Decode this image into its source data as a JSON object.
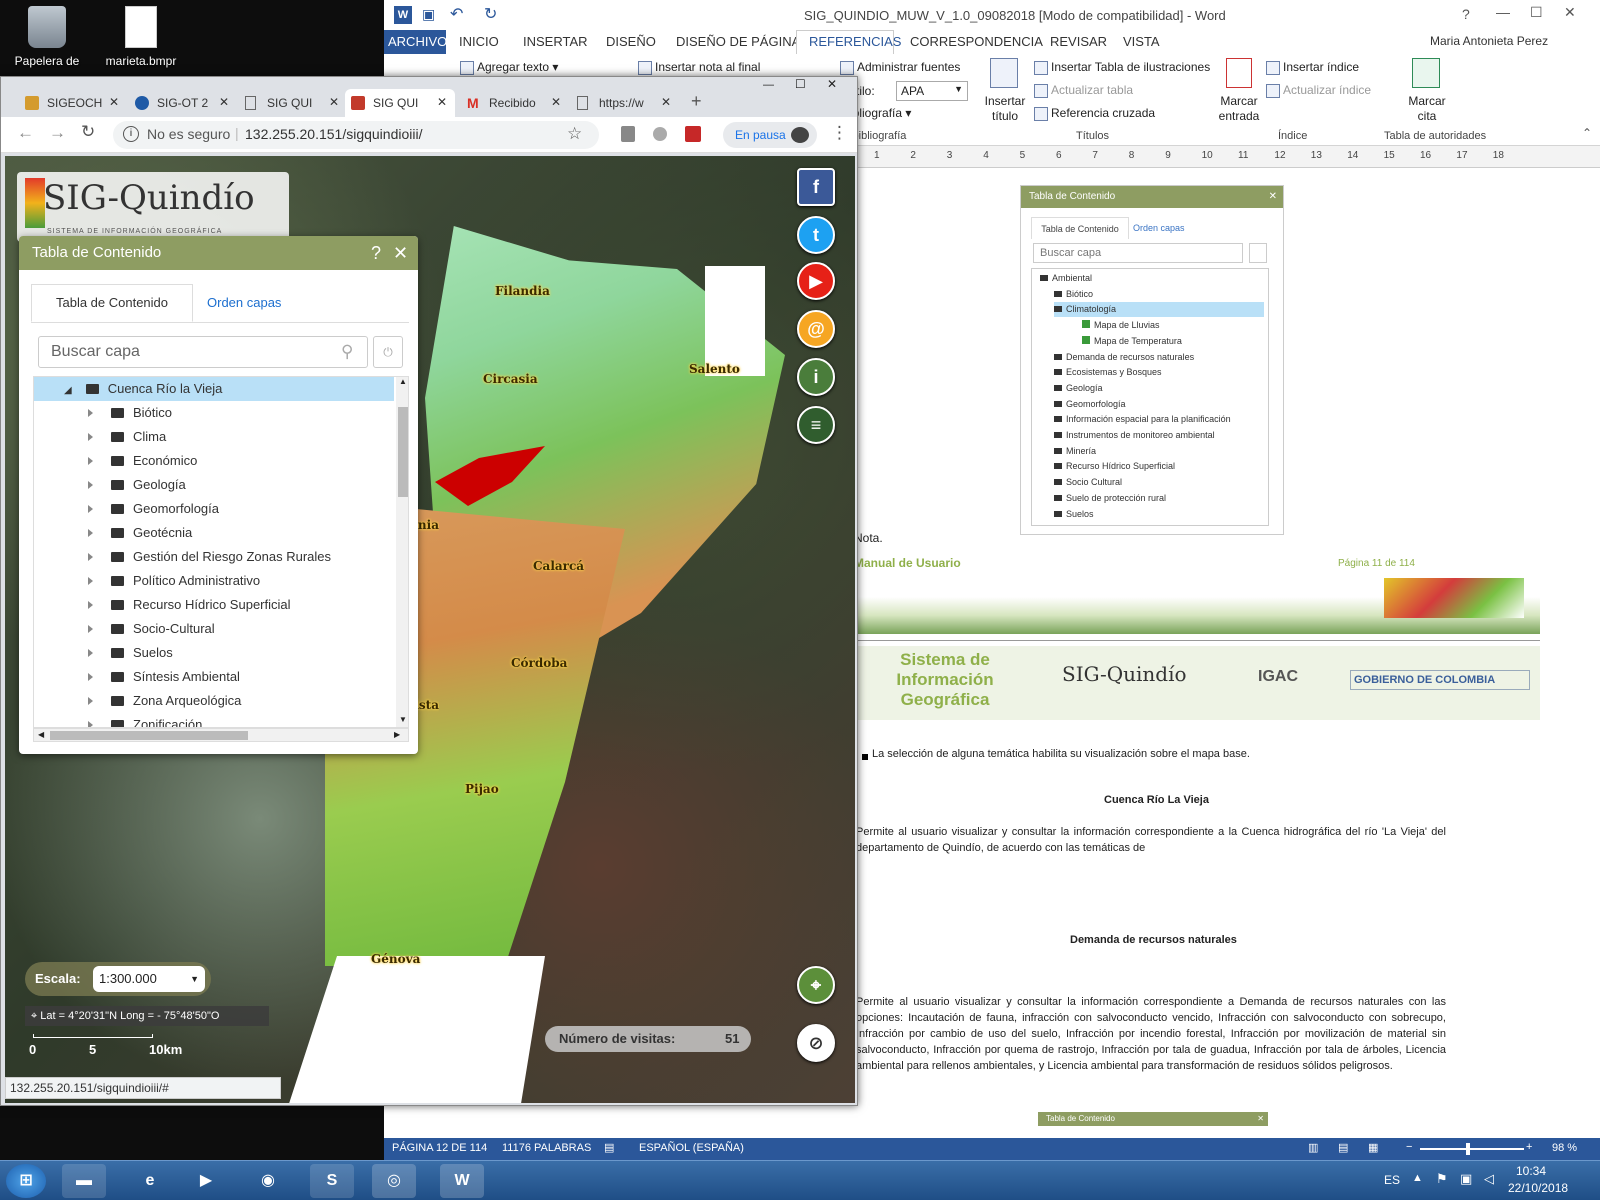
{
  "desktop": {
    "icons": [
      {
        "label": "Papelera de reciclaje"
      },
      {
        "label": "marieta.bmpr"
      }
    ]
  },
  "word": {
    "title": "SIG_QUINDIO_MUW_V_1.0_09082018 [Modo de compatibilidad] - Word",
    "tabs": [
      "ARCHIVO",
      "INICIO",
      "INSERTAR",
      "DISEÑO",
      "DISEÑO DE PÁGINA",
      "REFERENCIAS",
      "CORRESPONDENCIA",
      "REVISAR",
      "VISTA"
    ],
    "user": "Maria Antonieta Perez",
    "ribbon": {
      "agregar_texto": "Agregar texto",
      "insertar_nota": "Insertar nota al final",
      "administrar_fuentes": "Administrar fuentes",
      "estilo_label": "Estilo:",
      "estilo_value": "APA",
      "bibliografia": "Bibliografía",
      "insertar_titulo": "Insertar título",
      "insertar_tabla_ilustraciones": "Insertar Tabla de ilustraciones",
      "actualizar_tabla": "Actualizar tabla",
      "referencia_cruzada": "Referencia cruzada",
      "marcar_entrada": "Marcar entrada",
      "insertar_indice": "Insertar índice",
      "actualizar_indice": "Actualizar índice",
      "marcar_cita": "Marcar cita",
      "groups": {
        "bib": "y bibliografía",
        "titulos": "Títulos",
        "indice": "Índice",
        "autoridades": "Tabla de autoridades"
      }
    },
    "ruler_numbers": [
      "1",
      "2",
      "3",
      "4",
      "5",
      "6",
      "7",
      "8",
      "9",
      "10",
      "11",
      "12",
      "13",
      "14",
      "15",
      "16",
      "17",
      "18"
    ],
    "doc": {
      "panel": {
        "title": "Tabla de Contenido",
        "tab1": "Tabla de Contenido",
        "tab2": "Orden capas",
        "search": "Buscar capa",
        "tree": [
          "Ambiental",
          "Biótico",
          "Climatología",
          "Mapa de Lluvias",
          "Mapa de Temperatura",
          "Demanda de recursos naturales",
          "Ecosistemas y Bosques",
          "Geología",
          "Geomorfología",
          "Información espacial para la planificación",
          "Instrumentos de monitoreo ambiental",
          "Minería",
          "Recurso Hídrico Superficial",
          "Socio Cultural",
          "Suelo de protección rural",
          "Suelos"
        ]
      },
      "nota": "Nota.",
      "footer_left": "Manual de Usuario",
      "footer_right": "Página 11 de 114",
      "banner_text": "Sistema de Información Geográfica",
      "banner_logo": "SIG-Quindío",
      "banner_igac": "IGAC",
      "banner_gov": "GOBIERNO DE COLOMBIA",
      "bullet": "La selección de alguna temática habilita su visualización sobre el mapa base.",
      "h1": "Cuenca Río La Vieja",
      "p1": "Permite al usuario visualizar y consultar la información correspondiente a la Cuenca hidrográfica del río 'La Vieja' del departamento de Quindío, de acuerdo con las temáticas de",
      "h2": "Demanda de recursos naturales",
      "p2": "Permite al usuario visualizar y consultar la información correspondiente a Demanda de recursos naturales con las opciones: Incautación de fauna, infracción con salvoconducto vencido, Infracción con salvoconducto con sobrecupo, Infracción por cambio de uso del suelo, Infracción por incendio forestal, Infracción por movilización de material sin salvoconducto, Infracción por quema de rastrojo, Infracción por tala de guadua, Infracción por tala de árboles, Licencia ambiental para rellenos ambientales, y Licencia ambiental para transformación de residuos sólidos peligrosos.",
      "bottom_panel": "Tabla de Contenido"
    },
    "status": {
      "page": "PÁGINA 12 DE 114",
      "words": "11176 PALABRAS",
      "lang": "ESPAÑOL (ESPAÑA)",
      "zoom": "98 %"
    }
  },
  "chrome": {
    "tabs": [
      "SIGEOCH",
      "SIG-OT 2",
      "SIG QUI",
      "SIG QUI",
      "Recibido",
      "https://w"
    ],
    "url_warning": "No es seguro",
    "url": "132.255.20.151/sigquindioiii/",
    "paused": "En pausa",
    "status_url": "132.255.20.151/sigquindioiii/#"
  },
  "map": {
    "logo": "SIG-Quindío",
    "logo_sub": "SISTEMA DE INFORMACIÓN GEOGRÁFICA",
    "towns": [
      "Filandia",
      "Circasia",
      "Salento",
      "Armenia",
      "Calarcá",
      "Córdoba",
      "Buenavista",
      "Pijao",
      "Génova"
    ],
    "scale_label": "Escala:",
    "scale_value": "1:300.000",
    "coords": "Lat = 4°20'31\"N Long = - 75°48'50\"O",
    "scalebar": [
      "0",
      "5",
      "10km"
    ],
    "visits_label": "Número de visitas:",
    "visits_value": "51"
  },
  "toc": {
    "title": "Tabla de Contenido",
    "help": "?",
    "close": "✕",
    "tab1": "Tabla de Contenido",
    "tab2": "Orden capas",
    "search_placeholder": "Buscar capa",
    "root": "Cuenca Río la Vieja",
    "items": [
      "Biótico",
      "Clima",
      "Económico",
      "Geología",
      "Geomorfología",
      "Geotécnia",
      "Gestión del Riesgo Zonas Rurales",
      "Político Administrativo",
      "Recurso Hídrico Superficial",
      "Socio-Cultural",
      "Suelos",
      "Síntesis Ambiental",
      "Zona Arqueológica",
      "Zonificación"
    ]
  },
  "taskbar": {
    "lang": "ES",
    "time": "10:34",
    "date": "22/10/2018"
  }
}
